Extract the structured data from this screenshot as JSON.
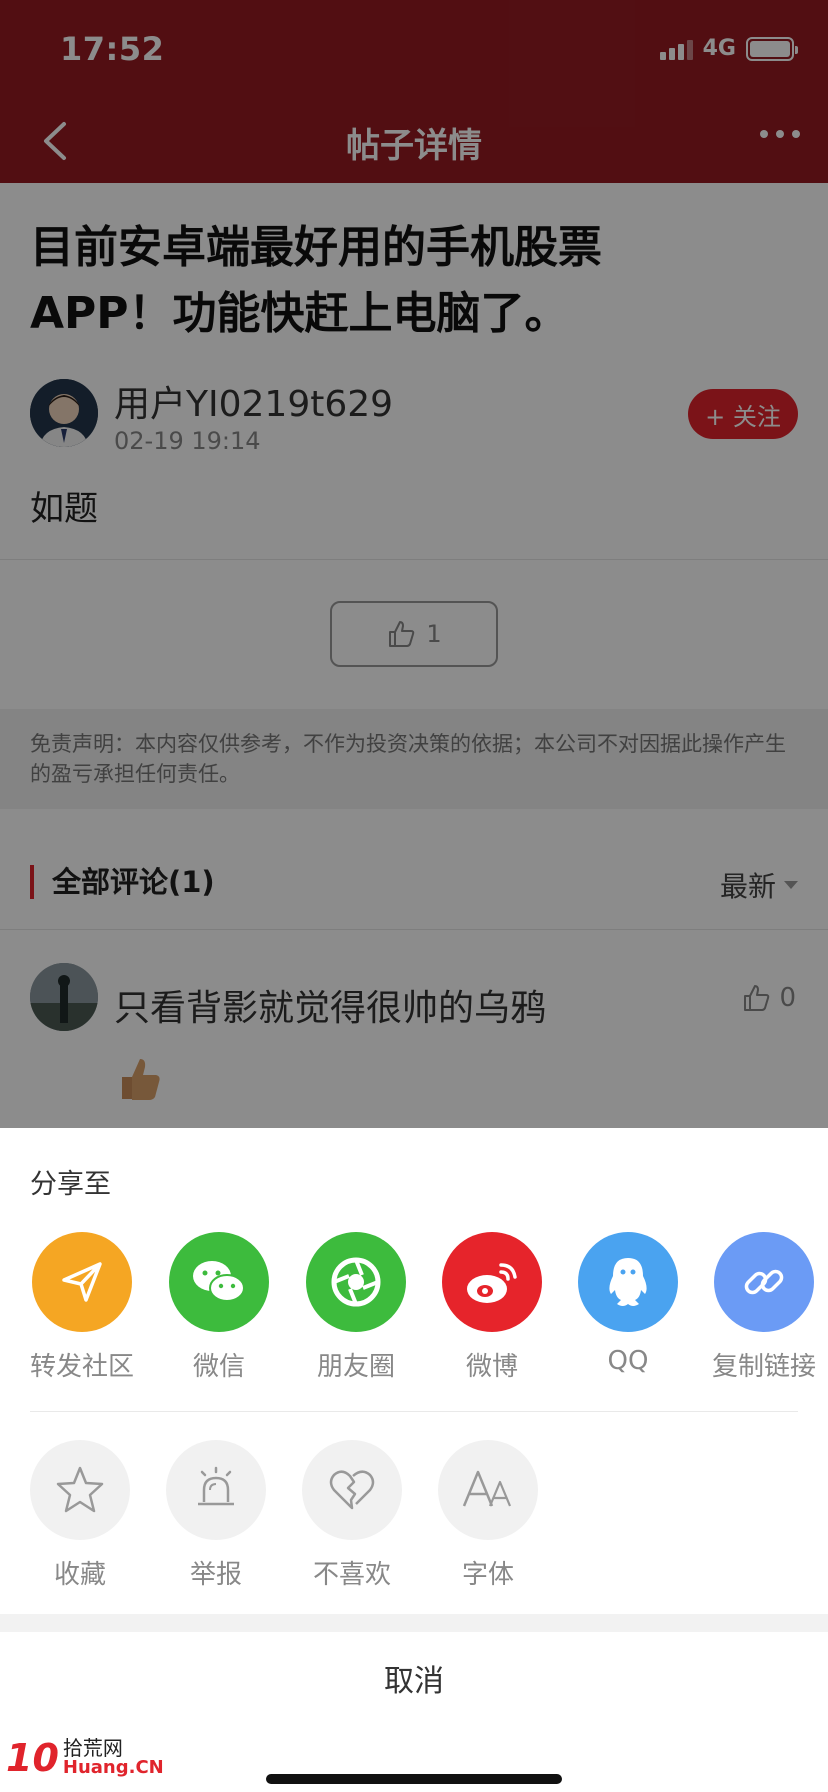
{
  "status_bar": {
    "time": "17:52",
    "network": "4G"
  },
  "nav": {
    "title": "帖子详情"
  },
  "post": {
    "title": "目前安卓端最好用的手机股票APP！功能快赶上电脑了。",
    "author": "用户YI0219t629",
    "time": "02-19 19:14",
    "follow_label": "+ 关注",
    "body": "如题",
    "like_count": "1"
  },
  "disclaimer": "免责声明：本内容仅供参考，不作为投资决策的依据；本公司不对因据此操作产生的盈亏承担任何责任。",
  "comments": {
    "header": "全部评论(1)",
    "sort": "最新",
    "items": [
      {
        "name": "只看背影就觉得很帅的乌鸦",
        "likes": "0"
      }
    ]
  },
  "share_sheet": {
    "title": "分享至",
    "share_items": [
      {
        "label": "转发社区",
        "icon": "send-icon",
        "color": "#f5a623"
      },
      {
        "label": "微信",
        "icon": "wechat-icon",
        "color": "#3dbb3d"
      },
      {
        "label": "朋友圈",
        "icon": "moments-icon",
        "color": "#3dbb3d"
      },
      {
        "label": "微博",
        "icon": "weibo-icon",
        "color": "#e6242b"
      },
      {
        "label": "QQ",
        "icon": "qq-icon",
        "color": "#4aa3f0"
      },
      {
        "label": "复制链接",
        "icon": "link-icon",
        "color": "#6b9bf5"
      }
    ],
    "action_items": [
      {
        "label": "收藏",
        "icon": "star-icon"
      },
      {
        "label": "举报",
        "icon": "alarm-icon"
      },
      {
        "label": "不喜欢",
        "icon": "broken-heart-icon"
      },
      {
        "label": "字体",
        "icon": "font-icon"
      }
    ],
    "cancel_label": "取消"
  },
  "watermark": {
    "logo": "10",
    "cn": "拾荒网",
    "en": "Huang.CN"
  }
}
